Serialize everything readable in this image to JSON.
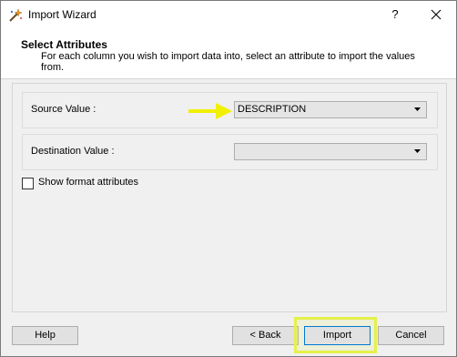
{
  "window": {
    "title": "Import Wizard",
    "help_symbol": "?",
    "close_symbol": "close-icon"
  },
  "header": {
    "title": "Select Attributes",
    "description": "For each column you wish to import data into, select an attribute to import the values from."
  },
  "form": {
    "source": {
      "label": "Source Value :",
      "value": "DESCRIPTION"
    },
    "destination": {
      "label": "Destination Value :",
      "value": ""
    },
    "show_format": {
      "label": "Show format attributes",
      "checked": false
    }
  },
  "buttons": {
    "help": "Help",
    "back": "< Back",
    "import": "Import",
    "cancel": "Cancel"
  },
  "colors": {
    "annotation_yellow": "#f0f000",
    "highlight_border": "#e6f04a"
  }
}
